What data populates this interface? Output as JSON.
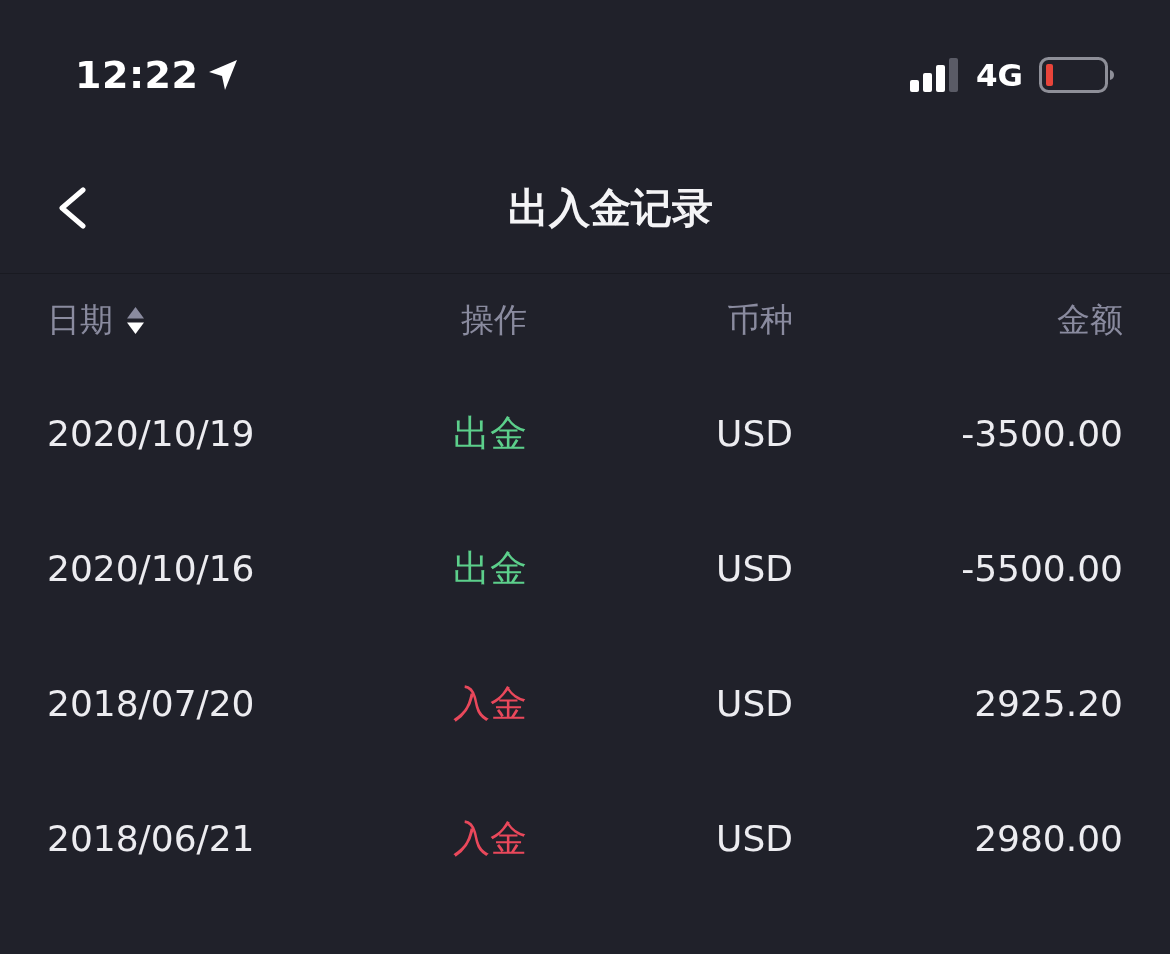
{
  "status_bar": {
    "time": "12:22",
    "network": "4G"
  },
  "nav_bar": {
    "title": "出入金记录"
  },
  "table": {
    "columns": [
      {
        "label": "日期",
        "sortable": true,
        "sort_descending": true
      },
      {
        "label": "操作",
        "sortable": false
      },
      {
        "label": "币种",
        "sortable": false
      },
      {
        "label": "金额",
        "sortable": false
      }
    ],
    "rows": [
      {
        "date": "2020/10/19",
        "operation": {
          "label": "出金",
          "color": "#5ccf8b"
        },
        "currency": "USD",
        "amount": "-3500.00"
      },
      {
        "date": "2020/10/16",
        "operation": {
          "label": "出金",
          "color": "#5ccf8b"
        },
        "currency": "USD",
        "amount": "-5500.00"
      },
      {
        "date": "2018/07/20",
        "operation": {
          "label": "入金",
          "color": "#e9485b"
        },
        "currency": "USD",
        "amount": "2925.20"
      },
      {
        "date": "2018/06/21",
        "operation": {
          "label": "入金",
          "color": "#e9485b"
        },
        "currency": "USD",
        "amount": "2980.00"
      }
    ]
  }
}
